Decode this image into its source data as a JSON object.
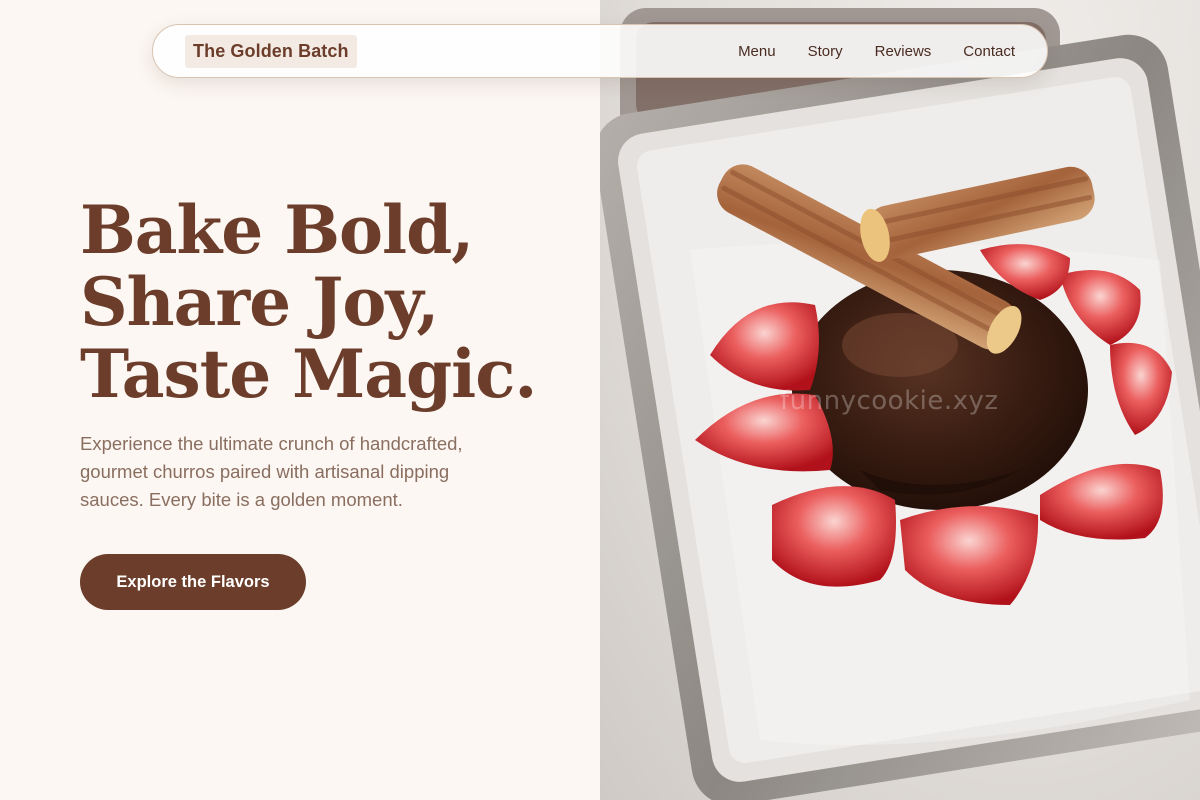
{
  "brand": {
    "name": "The Golden Batch"
  },
  "nav": {
    "links": [
      "Menu",
      "Story",
      "Reviews",
      "Contact"
    ]
  },
  "hero": {
    "title_lines": [
      "Bake Bold,",
      "Share Joy,",
      "Taste Magic."
    ],
    "description": "Experience the ultimate crunch of handcrafted, gourmet churros paired with artisanal dipping sauces. Every bite is a golden moment.",
    "cta_label": "Explore the Flavors"
  },
  "image": {
    "subject": "churros-with-chocolate-and-strawberries",
    "watermark": "funnycookie.xyz"
  },
  "colors": {
    "brand_brown": "#6b3d2a",
    "page_background": "#fcf7f2",
    "body_text": "#8a6e60",
    "brand_chip": "#f3ebe3"
  }
}
